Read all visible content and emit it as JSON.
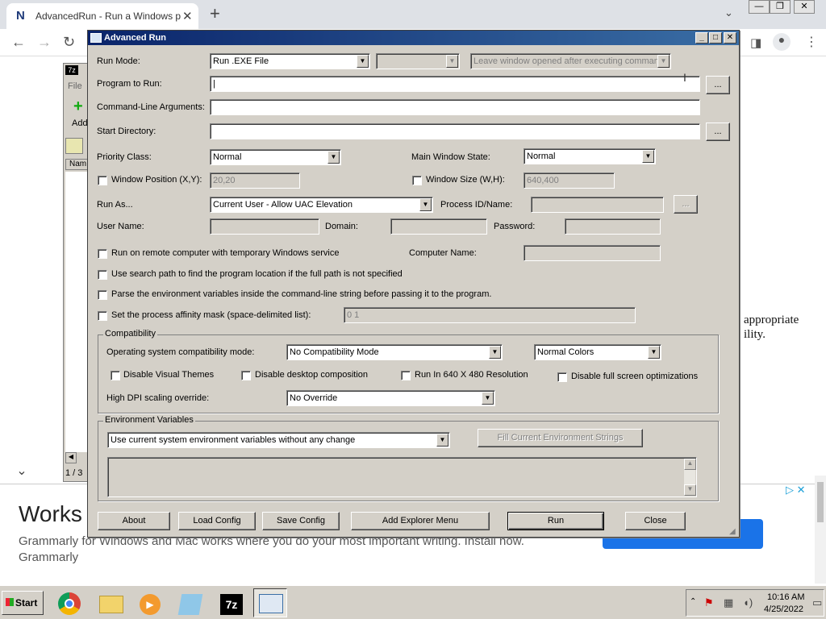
{
  "browser": {
    "tab_title": "AdvancedRun - Run a Windows pro",
    "tab_close": "✕",
    "new_tab": "+",
    "page_text_line1": "appropriate",
    "page_text_line2": "ility.",
    "ad_headline": "Works",
    "ad_body": "Grammarly for Windows and Mac works where you do your most important writing. Install now. Grammarly",
    "sevenzip_tab_file": "File",
    "sevenzip_tab_add": "Add",
    "sevenzip_col": "Nam",
    "sevenzip_status": "1 / 3"
  },
  "dialog": {
    "title": "Advanced Run",
    "run_mode_label": "Run Mode:",
    "run_mode_value": "Run .EXE File",
    "run_mode_extra": "",
    "leave_window": "Leave window opened after executing command",
    "program_label": "Program to Run:",
    "program_value": "|",
    "args_label": "Command-Line Arguments:",
    "args_value": "",
    "start_dir_label": "Start Directory:",
    "start_dir_value": "",
    "browse": "...",
    "priority_label": "Priority Class:",
    "priority_value": "Normal",
    "main_state_label": "Main Window State:",
    "main_state_value": "Normal",
    "win_pos_label": "Window Position (X,Y):",
    "win_pos_value": "20,20",
    "win_size_label": "Window Size (W,H):",
    "win_size_value": "640,400",
    "run_as_label": "Run As...",
    "run_as_value": "Current User - Allow UAC Elevation",
    "process_label": "Process ID/Name:",
    "process_value": "",
    "user_label": "User Name:",
    "domain_label": "Domain:",
    "password_label": "Password:",
    "remote_label": "Run on remote computer with temporary Windows service",
    "computer_label": "Computer Name:",
    "search_path_label": "Use search path to find the program location if the full path is not specified",
    "parse_env_label": "Parse the environment variables inside the command-line string before passing it to the program.",
    "affinity_label": "Set the process affinity mask (space-delimited list):",
    "affinity_value": "0 1",
    "compat_group": "Compatibility",
    "compat_mode_label": "Operating system compatibility mode:",
    "compat_mode_value": "No Compatibility Mode",
    "colors_value": "Normal Colors",
    "disable_themes": "Disable Visual Themes",
    "disable_desktop": "Disable desktop composition",
    "run_640": "Run In 640 X 480 Resolution",
    "disable_fullscreen": "Disable full screen optimizations",
    "dpi_label": "High DPI scaling override:",
    "dpi_value": "No Override",
    "env_group": "Environment Variables",
    "env_value": "Use current system environment variables without any change",
    "fill_env": "Fill Current Environment Strings",
    "about": "About",
    "load_config": "Load Config",
    "save_config": "Save Config",
    "add_explorer": "Add Explorer Menu",
    "run": "Run",
    "close": "Close"
  },
  "taskbar": {
    "start": "Start",
    "time": "10:16 AM",
    "date": "4/25/2022"
  },
  "colors": {
    "titlebar": "#0a246a",
    "dialog_bg": "#d4d0c8",
    "ad_button": "#1a73e8"
  }
}
